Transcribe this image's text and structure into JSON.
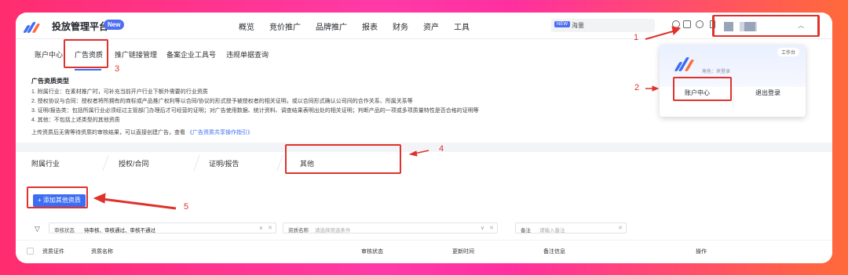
{
  "header": {
    "brand": "投放管理平台",
    "badge": "New",
    "nav": [
      "概览",
      "竞价推广",
      "品牌推广",
      "报表",
      "财务",
      "资产",
      "工具"
    ],
    "search_tag": "NEW",
    "search_placeholder": "海量"
  },
  "subnav": {
    "items": [
      "账户中心",
      "广告资质",
      "推广链接管理",
      "备案企业工具号",
      "违规单据查询"
    ]
  },
  "info": {
    "title": "广告资质类型",
    "lines": [
      "1. 附属行业：在素材推广时，可补充当前开户行业下额外需要的行业资质",
      "2. 授权协议与合同：授权者将所拥有的商标或产品推广权利等以合同/协议的形式授予被授权者的相关证明，或以合同形式确认公司间的合作关系、所属关系等",
      "3. 证明/报告类：包括所属行业必须经过主管部门办理后才可经营的证明；对广告使用数据、统计资料、调查结果表明出处的相关证明；判断产品的一项或多项质量特性是否合格的证明等",
      "4. 其他：不包括上述类型的其他资质"
    ],
    "footer_text": "上传资质后无需等待资质的审核结果，可以直接创建广告，查看",
    "footer_link": "《广告资质共享操作指引》"
  },
  "tabs": [
    "附属行业",
    "授权/合同",
    "证明/报告",
    "其他"
  ],
  "add_button": "+ 添加其他资质",
  "filters": {
    "status_label": "审核状态",
    "status_value": "待审核、审核通过、审核不通过",
    "name_label": "资质名称",
    "name_placeholder": "请选择筛选条件",
    "note_label": "备注",
    "note_placeholder": "请输入备注"
  },
  "table": {
    "columns": [
      "资质证件",
      "资质名称",
      "审核状态",
      "更新时间",
      "备注信息",
      "操作"
    ]
  },
  "popup": {
    "role_text": "角色：来登录",
    "workspace": "工作台",
    "account_center": "账户中心",
    "logout": "退出登录"
  },
  "annotations": [
    "1",
    "2",
    "3",
    "4",
    "5"
  ],
  "colors": {
    "accent": "#3d6df2",
    "annotation": "#e0322c"
  }
}
